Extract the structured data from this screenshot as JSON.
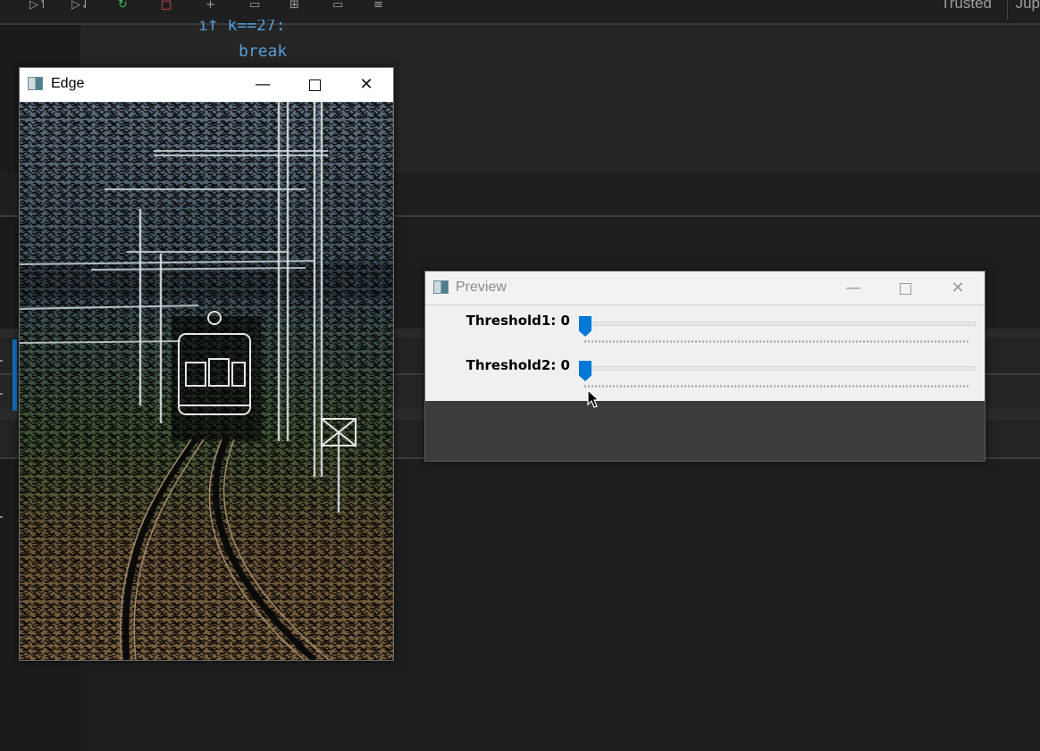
{
  "ide": {
    "trusted_label": "Trusted",
    "kernel_label": "Jup",
    "toolbar_icons": [
      "run-above-icon",
      "run-below-icon",
      "restart-icon",
      "stop-icon",
      "add-icon",
      "save-icon",
      "table-icon",
      "window-icon",
      "list-icon"
    ],
    "code": {
      "line1": "if k==27:",
      "line2": "break"
    },
    "colors": {
      "keyword": "#569cd6",
      "accent": "#0e70c0"
    }
  },
  "edge_window": {
    "title": "Edge",
    "controls": {
      "minimize": "—",
      "close": "✕"
    }
  },
  "preview_window": {
    "title": "Preview",
    "controls": {
      "minimize": "—",
      "close": "✕"
    },
    "trackbars": [
      {
        "label": "Threshold1: 0",
        "value": 0
      },
      {
        "label": "Threshold2: 0",
        "value": 0
      }
    ],
    "colors": {
      "slider_thumb": "#0078d7"
    }
  }
}
